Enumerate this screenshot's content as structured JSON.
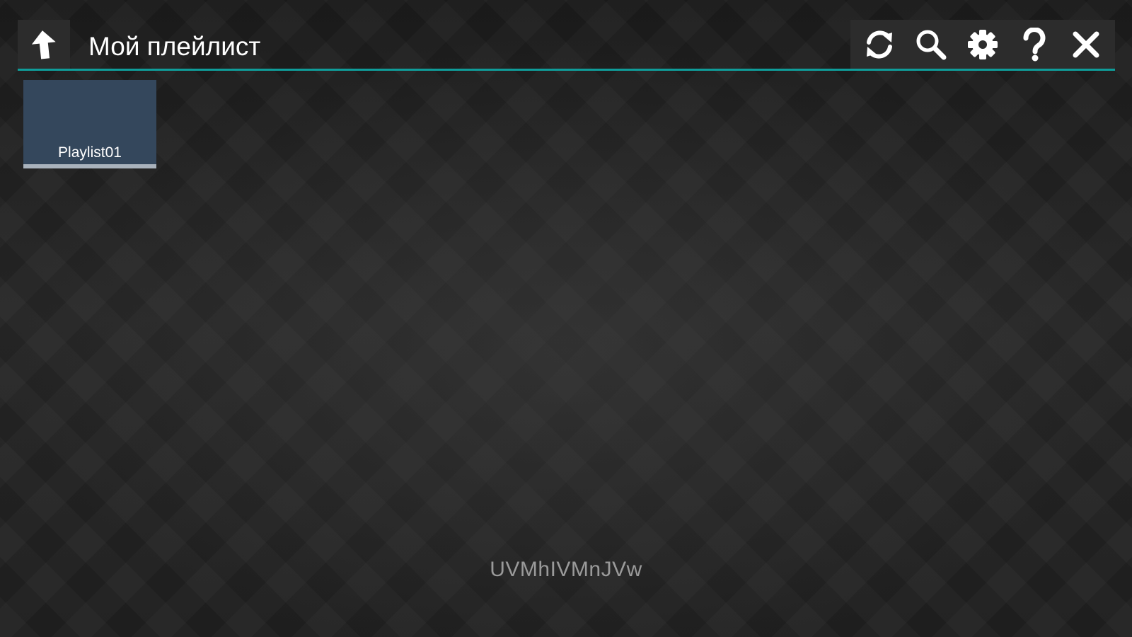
{
  "header": {
    "title": "Мой плейлист",
    "back_icon": "arrow-up-icon"
  },
  "toolbar": {
    "buttons": [
      {
        "id": "refresh",
        "icon": "refresh-icon"
      },
      {
        "id": "search",
        "icon": "search-icon"
      },
      {
        "id": "settings",
        "icon": "gear-icon"
      },
      {
        "id": "help",
        "icon": "help-icon"
      },
      {
        "id": "close",
        "icon": "close-icon"
      }
    ]
  },
  "playlists": [
    {
      "label": "Playlist01"
    }
  ],
  "footer": {
    "code": "UVMhIVMnJVw"
  },
  "colors": {
    "accent": "#0f9d9a",
    "tile": "#34475c",
    "tile_bar": "#a9b2bc",
    "bar_bg": "#2c2c2c",
    "code_text": "#9a9a9a"
  }
}
